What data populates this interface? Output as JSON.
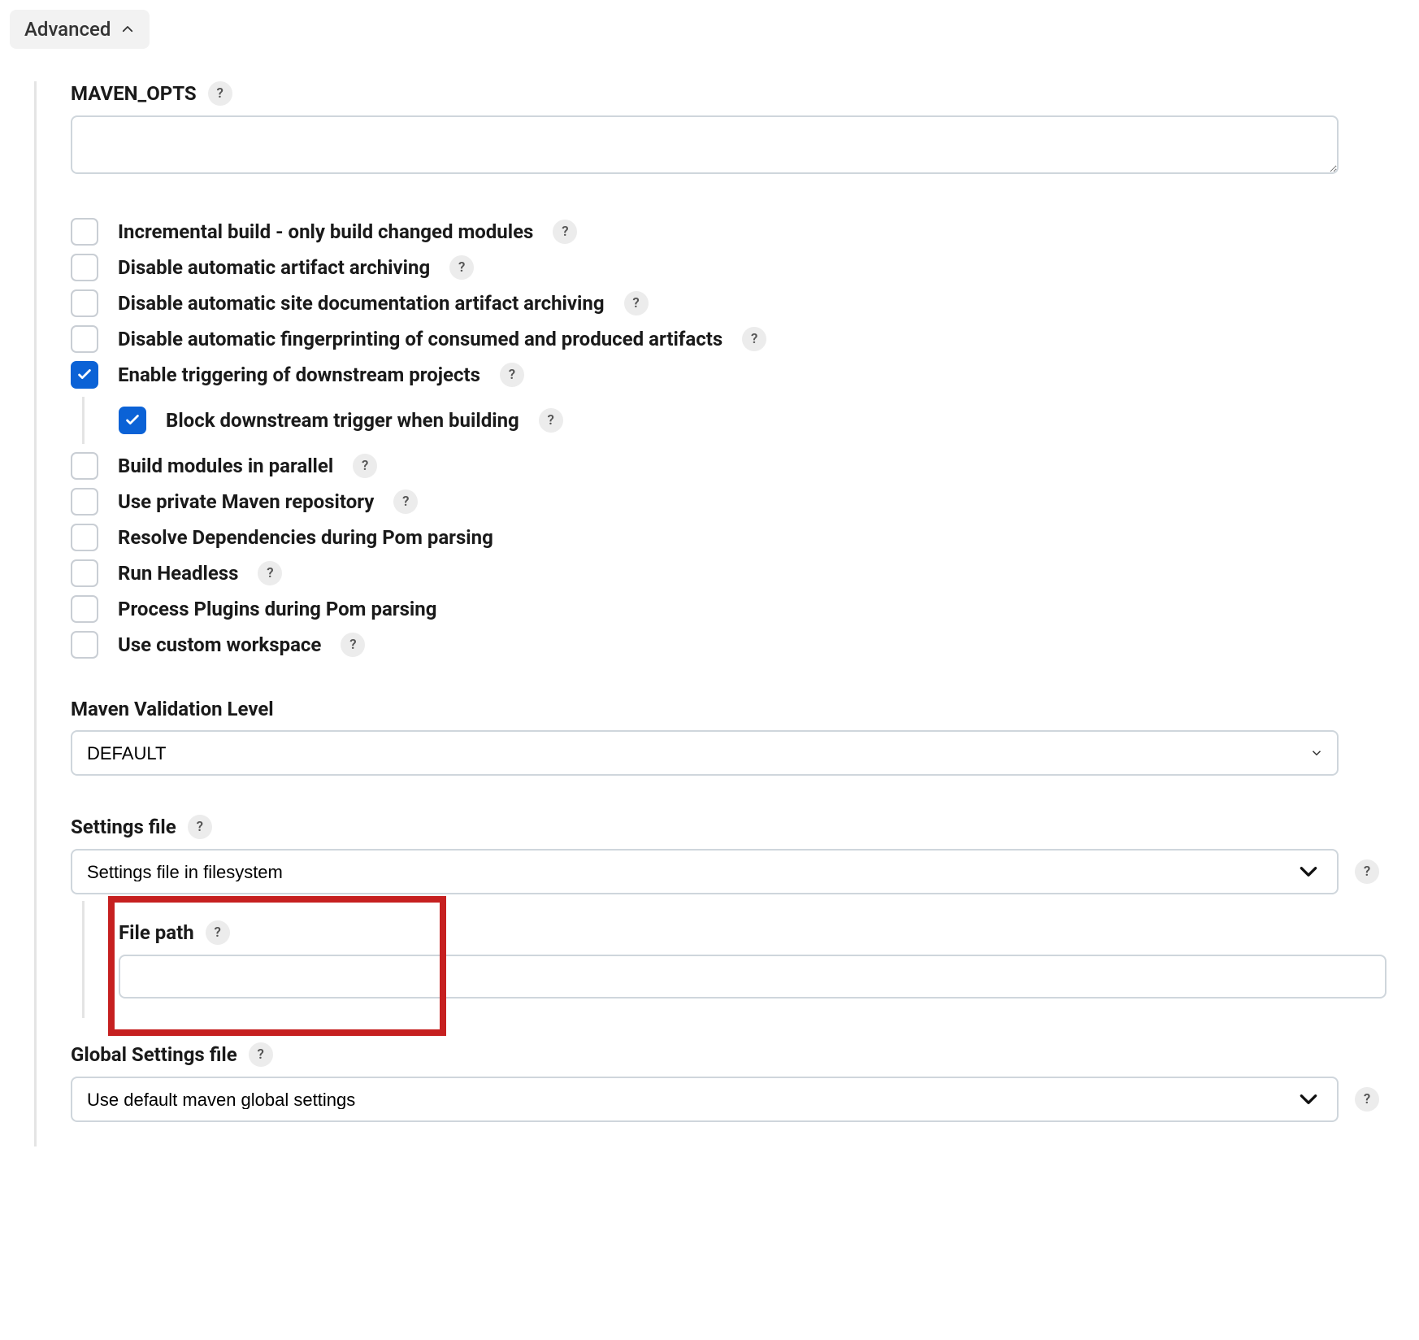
{
  "advanced": {
    "label": "Advanced"
  },
  "maven_opts": {
    "label": "MAVEN_OPTS",
    "value": ""
  },
  "checkboxes": {
    "incremental": {
      "label": "Incremental build - only build changed modules",
      "checked": false,
      "help": true
    },
    "disable_archiving": {
      "label": "Disable automatic artifact archiving",
      "checked": false,
      "help": true
    },
    "disable_site_archiving": {
      "label": "Disable automatic site documentation artifact archiving",
      "checked": false,
      "help": true
    },
    "disable_fingerprint": {
      "label": "Disable automatic fingerprinting of consumed and produced artifacts",
      "checked": false,
      "help": true
    },
    "enable_downstream": {
      "label": "Enable triggering of downstream projects",
      "checked": true,
      "help": true
    },
    "block_downstream": {
      "label": "Block downstream trigger when building",
      "checked": true,
      "help": true
    },
    "parallel": {
      "label": "Build modules in parallel",
      "checked": false,
      "help": true
    },
    "private_repo": {
      "label": "Use private Maven repository",
      "checked": false,
      "help": true
    },
    "resolve_deps": {
      "label": "Resolve Dependencies during Pom parsing",
      "checked": false,
      "help": false
    },
    "headless": {
      "label": "Run Headless",
      "checked": false,
      "help": true
    },
    "process_plugins": {
      "label": "Process Plugins during Pom parsing",
      "checked": false,
      "help": false
    },
    "custom_ws": {
      "label": "Use custom workspace",
      "checked": false,
      "help": true
    }
  },
  "validation": {
    "label": "Maven Validation Level",
    "value": "DEFAULT"
  },
  "settings_file": {
    "label": "Settings file",
    "value": "Settings file in filesystem"
  },
  "file_path": {
    "label": "File path",
    "value": ""
  },
  "global_settings": {
    "label": "Global Settings file",
    "value": "Use default maven global settings"
  },
  "help_glyph": "?"
}
